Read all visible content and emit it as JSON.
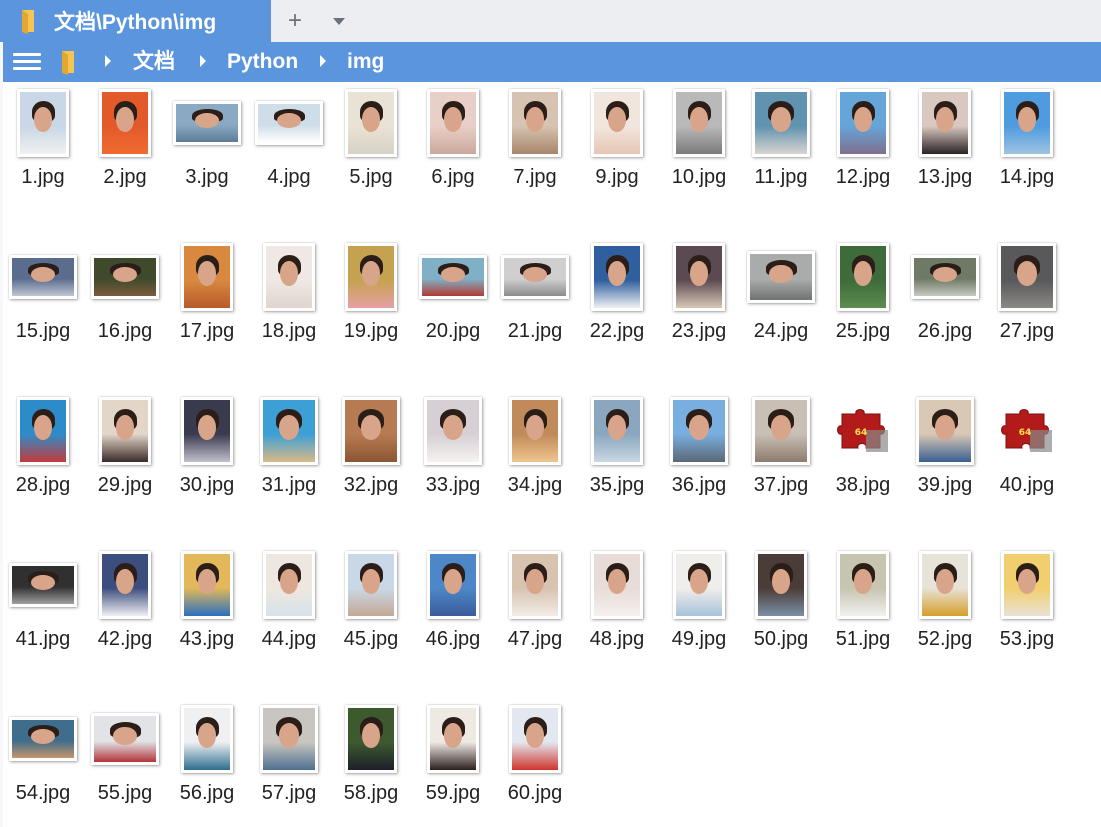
{
  "tab": {
    "title": "文档\\Python\\img",
    "new_tab_symbol": "+"
  },
  "address": {
    "crumbs": [
      "文档",
      "Python",
      "img"
    ]
  },
  "colors": {
    "accent": "#5b95de",
    "folder": "#f5c451"
  },
  "files": [
    {
      "name": "1.jpg",
      "thumb": "portrait",
      "bg": "#c9d7e6",
      "bottom": "#f0f0f0"
    },
    {
      "name": "2.jpg",
      "thumb": "portrait",
      "bg": "#e35a2a",
      "bottom": "#f06a30"
    },
    {
      "name": "3.jpg",
      "thumb": "landscape",
      "bg": "#8aa9c2",
      "bottom": "#5c7b96"
    },
    {
      "name": "4.jpg",
      "thumb": "landscape",
      "bg": "#cfdde8",
      "bottom": "#ffffff"
    },
    {
      "name": "5.jpg",
      "thumb": "portrait",
      "bg": "#e9e3d5",
      "bottom": "#d7d2c6"
    },
    {
      "name": "6.jpg",
      "thumb": "portrait",
      "bg": "#e8cfc7",
      "bottom": "#cba89d"
    },
    {
      "name": "7.jpg",
      "thumb": "portrait",
      "bg": "#d6c3b1",
      "bottom": "#a8866a"
    },
    {
      "name": "9.jpg",
      "thumb": "portrait",
      "bg": "#f1e6de",
      "bottom": "#e6c6b4"
    },
    {
      "name": "10.jpg",
      "thumb": "portrait",
      "bg": "#b9b9b9",
      "bottom": "#7a7a7a"
    },
    {
      "name": "11.jpg",
      "thumb": "portrait-wide",
      "bg": "#5f93b0",
      "bottom": "#d9d4cf"
    },
    {
      "name": "12.jpg",
      "thumb": "portrait",
      "bg": "#66a5d8",
      "bottom": "#7f6f8e"
    },
    {
      "name": "13.jpg",
      "thumb": "portrait",
      "bg": "#d9c8c0",
      "bottom": "#2a2225"
    },
    {
      "name": "14.jpg",
      "thumb": "portrait",
      "bg": "#4e9be0",
      "bottom": "#9fc3e0"
    },
    {
      "name": "15.jpg",
      "thumb": "landscape",
      "bg": "#5a6d8f",
      "bottom": "#c0c6d2"
    },
    {
      "name": "16.jpg",
      "thumb": "landscape",
      "bg": "#3f4a2c",
      "bottom": "#7b5b3b"
    },
    {
      "name": "17.jpg",
      "thumb": "portrait",
      "bg": "#d9893f",
      "bottom": "#b85a2a"
    },
    {
      "name": "18.jpg",
      "thumb": "portrait",
      "bg": "#f0e8e4",
      "bottom": "#e0d4cf"
    },
    {
      "name": "19.jpg",
      "thumb": "portrait",
      "bg": "#c5a24f",
      "bottom": "#e6a0a6"
    },
    {
      "name": "20.jpg",
      "thumb": "landscape",
      "bg": "#7fb0c6",
      "bottom": "#b33b35"
    },
    {
      "name": "21.jpg",
      "thumb": "landscape",
      "bg": "#cfcfcf",
      "bottom": "#8c8c8c"
    },
    {
      "name": "22.jpg",
      "thumb": "portrait",
      "bg": "#2f5f9f",
      "bottom": "#f0f0f4"
    },
    {
      "name": "23.jpg",
      "thumb": "portrait",
      "bg": "#5c4a52",
      "bottom": "#d8c8b6"
    },
    {
      "name": "24.jpg",
      "thumb": "landscape-tall",
      "bg": "#a9acab",
      "bottom": "#6e7270"
    },
    {
      "name": "25.jpg",
      "thumb": "portrait",
      "bg": "#3e6b3a",
      "bottom": "#5d8d4f"
    },
    {
      "name": "26.jpg",
      "thumb": "landscape",
      "bg": "#6f7a66",
      "bottom": "#c6c9c2"
    },
    {
      "name": "27.jpg",
      "thumb": "portrait-wide",
      "bg": "#59585b",
      "bottom": "#8a8985"
    },
    {
      "name": "28.jpg",
      "thumb": "portrait",
      "bg": "#2e8bc9",
      "bottom": "#c33a3a"
    },
    {
      "name": "29.jpg",
      "thumb": "portrait",
      "bg": "#e3d6c8",
      "bottom": "#3a2a2a"
    },
    {
      "name": "30.jpg",
      "thumb": "portrait",
      "bg": "#3a3a4e",
      "bottom": "#c0c0cc"
    },
    {
      "name": "31.jpg",
      "thumb": "portrait-wide",
      "bg": "#3c9fd6",
      "bottom": "#d9b986"
    },
    {
      "name": "32.jpg",
      "thumb": "portrait-wide",
      "bg": "#b77b53",
      "bottom": "#8b5634"
    },
    {
      "name": "33.jpg",
      "thumb": "portrait-wide",
      "bg": "#d6cfd3",
      "bottom": "#f6f2f0"
    },
    {
      "name": "34.jpg",
      "thumb": "portrait",
      "bg": "#c08a5a",
      "bottom": "#f0c58e"
    },
    {
      "name": "35.jpg",
      "thumb": "portrait",
      "bg": "#8aa7bf",
      "bottom": "#c9d7e2"
    },
    {
      "name": "36.jpg",
      "thumb": "portrait-wide",
      "bg": "#79aee0",
      "bottom": "#5a6876"
    },
    {
      "name": "37.jpg",
      "thumb": "portrait-wide",
      "bg": "#c9bfb5",
      "bottom": "#8d7c6e"
    },
    {
      "name": "38.jpg",
      "thumb": "puzzle",
      "bg": "#b31b1b",
      "bottom": "#8a8a8a"
    },
    {
      "name": "39.jpg",
      "thumb": "portrait-wide",
      "bg": "#d8c8b4",
      "bottom": "#3a5e92"
    },
    {
      "name": "40.jpg",
      "thumb": "puzzle",
      "bg": "#b31b1b",
      "bottom": "#8a8a8a"
    },
    {
      "name": "41.jpg",
      "thumb": "landscape",
      "bg": "#303030",
      "bottom": "#a0a0a0"
    },
    {
      "name": "42.jpg",
      "thumb": "portrait",
      "bg": "#3c4e7e",
      "bottom": "#f0eef2"
    },
    {
      "name": "43.jpg",
      "thumb": "portrait",
      "bg": "#e2b85a",
      "bottom": "#2b6fbf"
    },
    {
      "name": "44.jpg",
      "thumb": "portrait",
      "bg": "#eee7df",
      "bottom": "#d7e2ea"
    },
    {
      "name": "45.jpg",
      "thumb": "portrait",
      "bg": "#c9d8e7",
      "bottom": "#c4a895"
    },
    {
      "name": "46.jpg",
      "thumb": "portrait",
      "bg": "#4d87c7",
      "bottom": "#3a5c9a"
    },
    {
      "name": "47.jpg",
      "thumb": "portrait",
      "bg": "#d8c2b0",
      "bottom": "#f2ece6"
    },
    {
      "name": "48.jpg",
      "thumb": "portrait",
      "bg": "#e7dcd8",
      "bottom": "#f6f0ee"
    },
    {
      "name": "49.jpg",
      "thumb": "portrait",
      "bg": "#f0eeea",
      "bottom": "#a7c2da"
    },
    {
      "name": "50.jpg",
      "thumb": "portrait",
      "bg": "#4a3d37",
      "bottom": "#7b8fa6"
    },
    {
      "name": "51.jpg",
      "thumb": "portrait",
      "bg": "#c7c4b0",
      "bottom": "#f0f0f0"
    },
    {
      "name": "52.jpg",
      "thumb": "portrait",
      "bg": "#e7e3d9",
      "bottom": "#d59e2a"
    },
    {
      "name": "53.jpg",
      "thumb": "portrait",
      "bg": "#f2cf6e",
      "bottom": "#e8e2d6"
    },
    {
      "name": "54.jpg",
      "thumb": "landscape",
      "bg": "#3f6e8c",
      "bottom": "#c7956e"
    },
    {
      "name": "55.jpg",
      "thumb": "landscape-tall",
      "bg": "#e1e3e6",
      "bottom": "#b2353a"
    },
    {
      "name": "56.jpg",
      "thumb": "portrait",
      "bg": "#eef0f2",
      "bottom": "#2d6d8e"
    },
    {
      "name": "57.jpg",
      "thumb": "portrait-wide",
      "bg": "#c9c6c1",
      "bottom": "#4e6f8f"
    },
    {
      "name": "58.jpg",
      "thumb": "portrait",
      "bg": "#3c5a2e",
      "bottom": "#1e1e2a"
    },
    {
      "name": "59.jpg",
      "thumb": "portrait",
      "bg": "#efe9e4",
      "bottom": "#2b1f1c"
    },
    {
      "name": "60.jpg",
      "thumb": "portrait",
      "bg": "#e3e7ef",
      "bottom": "#d0342c"
    }
  ]
}
